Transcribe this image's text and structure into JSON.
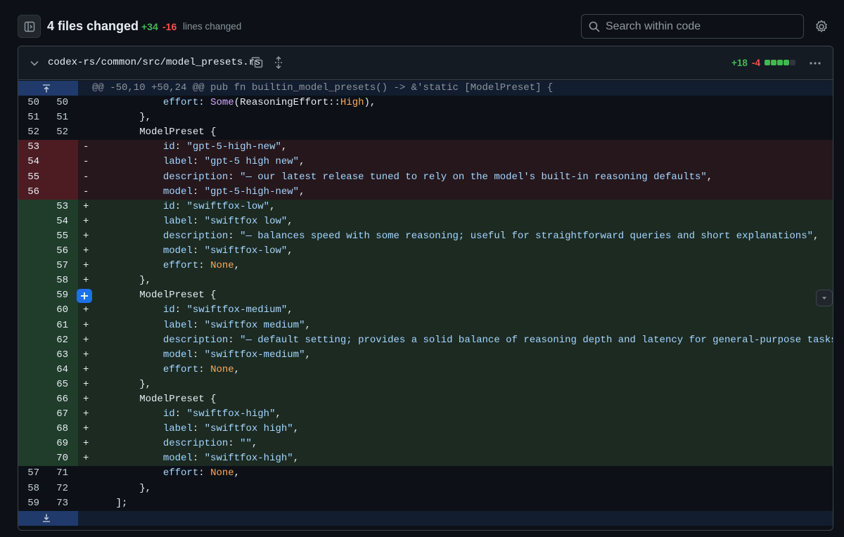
{
  "header": {
    "title": "4 files changed",
    "additions": "+34",
    "deletions": "-16",
    "lines_changed_label": "lines changed",
    "search_placeholder": "Search within code"
  },
  "file": {
    "path": "codex-rs/common/src/model_presets.rs",
    "additions": "+18",
    "deletions": "-4",
    "diffstat_colors": [
      "#3fb950",
      "#3fb950",
      "#3fb950",
      "#3fb950",
      "#30363d"
    ]
  },
  "hunk": {
    "header": "@@ -50,10 +50,24 @@ pub fn builtin_model_presets() -> &'static [ModelPreset] {"
  },
  "lines": [
    {
      "type": "ctx",
      "old": "50",
      "new": "50",
      "sign": "",
      "code": "            effort: Some(ReasoningEffort::High),"
    },
    {
      "type": "ctx",
      "old": "51",
      "new": "51",
      "sign": "",
      "code": "        },"
    },
    {
      "type": "ctx",
      "old": "52",
      "new": "52",
      "sign": "",
      "code": "        ModelPreset {"
    },
    {
      "type": "del",
      "old": "53",
      "new": "",
      "sign": "-",
      "code": "            id: \"gpt-5-high-new\","
    },
    {
      "type": "del",
      "old": "54",
      "new": "",
      "sign": "-",
      "code": "            label: \"gpt-5 high new\","
    },
    {
      "type": "del",
      "old": "55",
      "new": "",
      "sign": "-",
      "code": "            description: \"— our latest release tuned to rely on the model's built-in reasoning defaults\","
    },
    {
      "type": "del",
      "old": "56",
      "new": "",
      "sign": "-",
      "code": "            model: \"gpt-5-high-new\","
    },
    {
      "type": "add",
      "old": "",
      "new": "53",
      "sign": "+",
      "code": "            id: \"swiftfox-low\","
    },
    {
      "type": "add",
      "old": "",
      "new": "54",
      "sign": "+",
      "code": "            label: \"swiftfox low\","
    },
    {
      "type": "add",
      "old": "",
      "new": "55",
      "sign": "+",
      "code": "            description: \"— balances speed with some reasoning; useful for straightforward queries and short explanations\","
    },
    {
      "type": "add",
      "old": "",
      "new": "56",
      "sign": "+",
      "code": "            model: \"swiftfox-low\","
    },
    {
      "type": "add",
      "old": "",
      "new": "57",
      "sign": "+",
      "code": "            effort: None,"
    },
    {
      "type": "add",
      "old": "",
      "new": "58",
      "sign": "+",
      "code": "        },"
    },
    {
      "type": "add",
      "old": "",
      "new": "59",
      "sign": "+",
      "code": "        ModelPreset {"
    },
    {
      "type": "add",
      "old": "",
      "new": "60",
      "sign": "+",
      "code": "            id: \"swiftfox-medium\","
    },
    {
      "type": "add",
      "old": "",
      "new": "61",
      "sign": "+",
      "code": "            label: \"swiftfox medium\","
    },
    {
      "type": "add",
      "old": "",
      "new": "62",
      "sign": "+",
      "code": "            description: \"— default setting; provides a solid balance of reasoning depth and latency for general-purpose tasks\","
    },
    {
      "type": "add",
      "old": "",
      "new": "63",
      "sign": "+",
      "code": "            model: \"swiftfox-medium\","
    },
    {
      "type": "add",
      "old": "",
      "new": "64",
      "sign": "+",
      "code": "            effort: None,"
    },
    {
      "type": "add",
      "old": "",
      "new": "65",
      "sign": "+",
      "code": "        },"
    },
    {
      "type": "add",
      "old": "",
      "new": "66",
      "sign": "+",
      "code": "        ModelPreset {"
    },
    {
      "type": "add",
      "old": "",
      "new": "67",
      "sign": "+",
      "code": "            id: \"swiftfox-high\","
    },
    {
      "type": "add",
      "old": "",
      "new": "68",
      "sign": "+",
      "code": "            label: \"swiftfox high\","
    },
    {
      "type": "add",
      "old": "",
      "new": "69",
      "sign": "+",
      "code": "            description: \"\","
    },
    {
      "type": "add",
      "old": "",
      "new": "70",
      "sign": "+",
      "code": "            model: \"swiftfox-high\","
    },
    {
      "type": "ctx",
      "old": "57",
      "new": "71",
      "sign": "",
      "code": "            effort: None,"
    },
    {
      "type": "ctx",
      "old": "58",
      "new": "72",
      "sign": "",
      "code": "        },"
    },
    {
      "type": "ctx",
      "old": "59",
      "new": "73",
      "sign": "",
      "code": "    ];"
    }
  ]
}
